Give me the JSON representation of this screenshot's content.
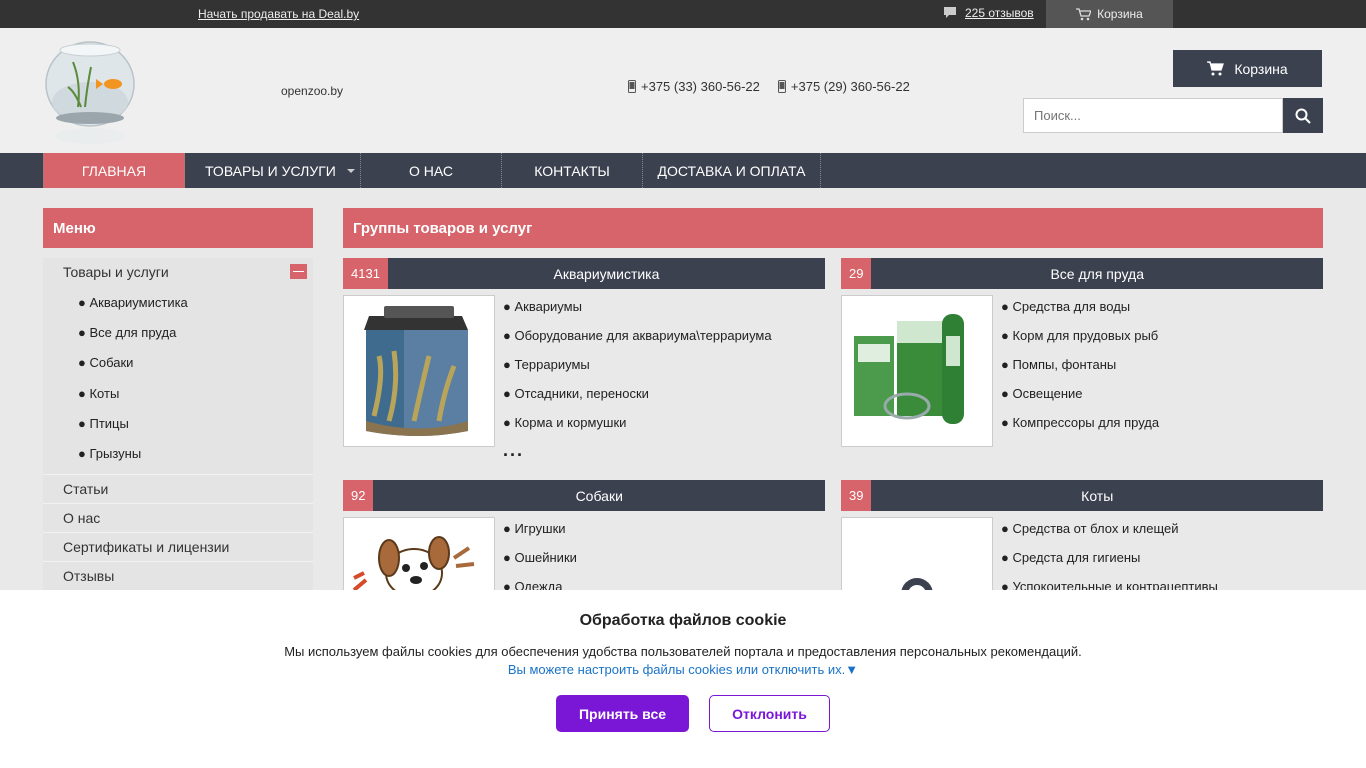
{
  "topbar": {
    "sell_link": "Начать продавать на Deal.by",
    "reviews": "225 отзывов",
    "cart": "Корзина"
  },
  "header": {
    "site_name": "openzoo.by",
    "phone1": "+375 (33) 360-56-22",
    "phone2": "+375 (29) 360-56-22",
    "cart_button": "Корзина",
    "search_placeholder": "Поиск..."
  },
  "nav": {
    "items": [
      {
        "label": "ГЛАВНАЯ"
      },
      {
        "label": "ТОВАРЫ И УСЛУГИ"
      },
      {
        "label": "О НАС"
      },
      {
        "label": "КОНТАКТЫ"
      },
      {
        "label": "ДОСТАВКА И ОПЛАТА"
      }
    ]
  },
  "sidebar": {
    "title": "Меню",
    "category": "Товары и услуги",
    "subitems": [
      "Аквариумистика",
      "Все для пруда",
      "Собаки",
      "Коты",
      "Птицы",
      "Грызуны"
    ],
    "links": [
      "Статьи",
      "О нас",
      "Сертификаты и лицензии",
      "Отзывы"
    ]
  },
  "main": {
    "title": "Группы товаров и услуг",
    "groups": [
      {
        "count": "4131",
        "title": "Аквариумистика",
        "items": [
          "● Аквариумы",
          "● Оборудование для аквариума\\террариума",
          "● Террариумы",
          "● Отсадники, переноски",
          "● Корма и кормушки"
        ],
        "more": "..."
      },
      {
        "count": "29",
        "title": "Все для пруда",
        "items": [
          "● Средства для воды",
          "● Корм для прудовых рыб",
          "● Помпы, фонтаны",
          "● Освещение",
          "● Компрессоры для пруда"
        ]
      },
      {
        "count": "92",
        "title": "Собаки",
        "items": [
          "● Игрушки",
          "● Ошейники",
          "● Одежда"
        ]
      },
      {
        "count": "39",
        "title": "Коты",
        "items": [
          "● Средства от блох и клещей",
          "● Средста для гигиены",
          "● Успокоительные и контрацептивы"
        ]
      }
    ]
  },
  "cookie": {
    "title": "Обработка файлов cookie",
    "text": "Мы используем файлы cookies для обеспечения удобства пользователей портала и предоставления персональных рекомендаций.",
    "link": "Вы можете настроить файлы cookies или отключить их.▼",
    "accept": "Принять все",
    "decline": "Отклонить"
  },
  "colors": {
    "accent": "#d6646a",
    "dark": "#3c4150",
    "cookie_button": "#7a17d6"
  }
}
